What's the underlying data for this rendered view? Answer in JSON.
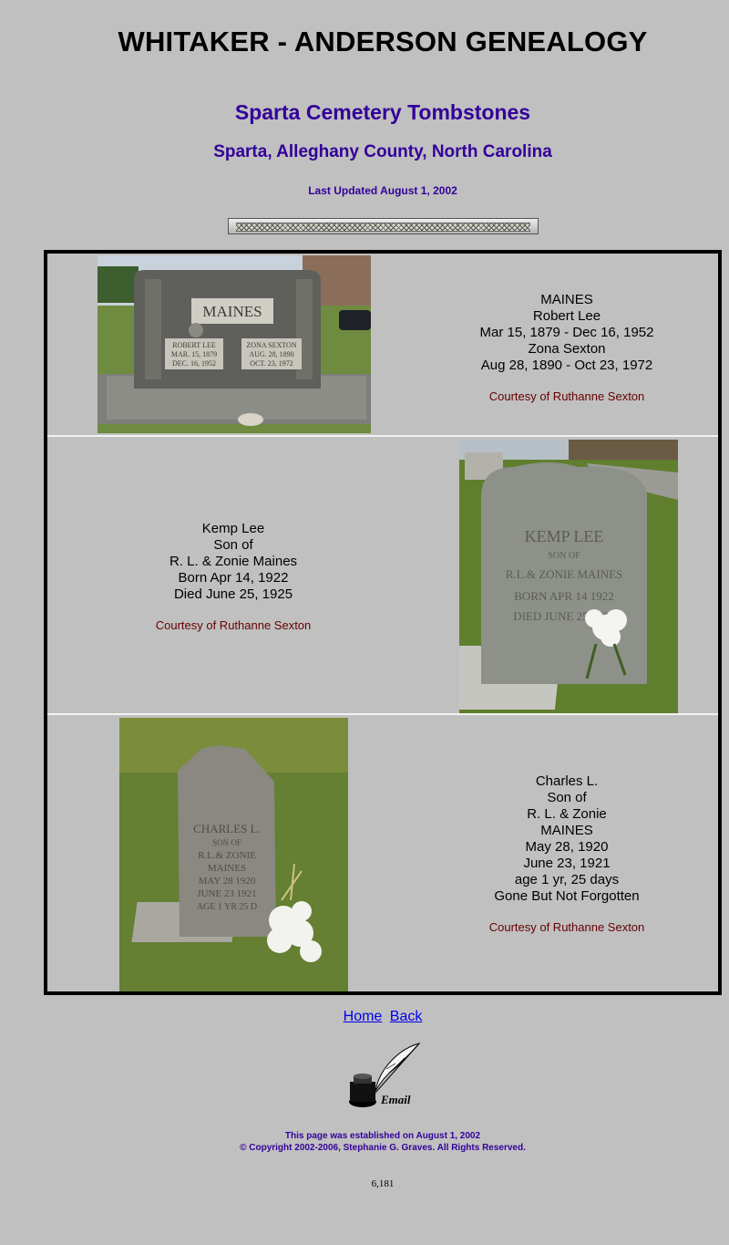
{
  "header": {
    "title": "WHITAKER - ANDERSON GENEALOGY",
    "subtitle": "Sparta Cemetery Tombstones",
    "location": "Sparta, Alleghany County, North Carolina",
    "updated": "Last Updated August 1, 2002"
  },
  "entries": [
    {
      "engraving": {
        "family": "MAINES",
        "left": [
          "ROBERT LEE",
          "MAR. 15, 1879",
          "DEC. 16, 1952"
        ],
        "right": [
          "ZONA SEXTON",
          "AUG. 28, 1890",
          "OCT. 23, 1972"
        ]
      },
      "lines": [
        "MAINES",
        "Robert Lee",
        "Mar 15, 1879 - Dec 16, 1952",
        "Zona Sexton",
        "Aug 28, 1890 - Oct 23, 1972"
      ],
      "credit": "Courtesy of Ruthanne Sexton"
    },
    {
      "engraving": {
        "lines": [
          "KEMP LEE",
          "SON OF",
          "R.L.& ZONIE MAINES",
          "BORN APR 14 1922",
          "DIED JUNE 25 1925"
        ]
      },
      "lines": [
        "Kemp Lee",
        "Son of",
        "R. L. & Zonie Maines",
        "Born Apr 14, 1922",
        "Died June 25, 1925"
      ],
      "credit": "Courtesy of Ruthanne Sexton"
    },
    {
      "engraving": {
        "lines": [
          "CHARLES L.",
          "SON OF",
          "R.L.& ZONIE",
          "MAINES",
          "MAY 28 1920",
          "JUNE 23 1921",
          "AGE 1 YR 25 D"
        ]
      },
      "lines": [
        "Charles L.",
        "Son of",
        "R. L. & Zonie",
        "MAINES",
        "May 28, 1920",
        "June 23, 1921",
        "age 1 yr, 25 days",
        "Gone But Not Forgotten"
      ],
      "credit": "Courtesy of Ruthanne Sexton"
    }
  ],
  "nav": {
    "home": "Home",
    "back": "Back"
  },
  "email": {
    "label": "Email",
    "icon": "quill-inkwell-icon"
  },
  "footer": {
    "established": "This page was established on August 1, 2002",
    "copyright": "© Copyright 2002-2006, Stephanie G. Graves. All Rights Reserved."
  },
  "counter": "6,181",
  "colors": {
    "background": "#c0c0c0",
    "heading": "#330099",
    "credit": "#660000",
    "link": "#0000ee"
  }
}
